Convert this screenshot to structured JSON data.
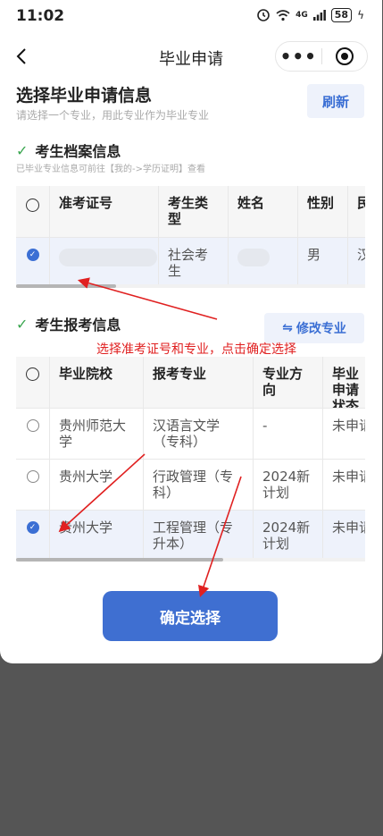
{
  "status_bar": {
    "time": "11:02",
    "signal": "4G",
    "battery": "58"
  },
  "nav": {
    "title": "毕业申请",
    "more_glyph": "•••"
  },
  "page": {
    "title": "选择毕业申请信息",
    "subtitle": "请选择一个专业，用此专业作为毕业专业",
    "refresh_label": "刷新"
  },
  "archive": {
    "title": "考生档案信息",
    "hint": "已毕业专业信息可前往【我的->学历证明】查看",
    "columns": [
      "准考证号",
      "考生类型",
      "姓名",
      "性别",
      "民"
    ],
    "rows": [
      {
        "selected": true,
        "exam_no": "",
        "type": "社会考生",
        "name": "",
        "gender": "男",
        "ethnic": "汉"
      }
    ]
  },
  "registration": {
    "title": "考生报考信息",
    "modify_label": "修改专业",
    "columns": [
      "毕业院校",
      "报考专业",
      "专业方向",
      "毕业申请状态"
    ],
    "rows": [
      {
        "selected": false,
        "school": "贵州师范大学",
        "major": "汉语言文学（专科）",
        "direction": "-",
        "status": "未申请"
      },
      {
        "selected": false,
        "school": "贵州大学",
        "major": "行政管理（专科）",
        "direction": "2024新计划",
        "status": "未申请"
      },
      {
        "selected": true,
        "school": "贵州大学",
        "major": "工程管理（专升本）",
        "direction": "2024新计划",
        "status": "未申请"
      }
    ]
  },
  "annotation": "选择准考证号和专业，点击确定选择",
  "confirm_label": "确定选择",
  "colors": {
    "accent": "#3f6fd1",
    "check": "#3aa64f",
    "annotation": "#e02020",
    "backdrop": "#555555"
  },
  "icons": {
    "back": "chevron-left-icon",
    "more": "more-dots-icon",
    "target": "target-icon",
    "swap": "swap-icon",
    "check": "check-icon"
  }
}
